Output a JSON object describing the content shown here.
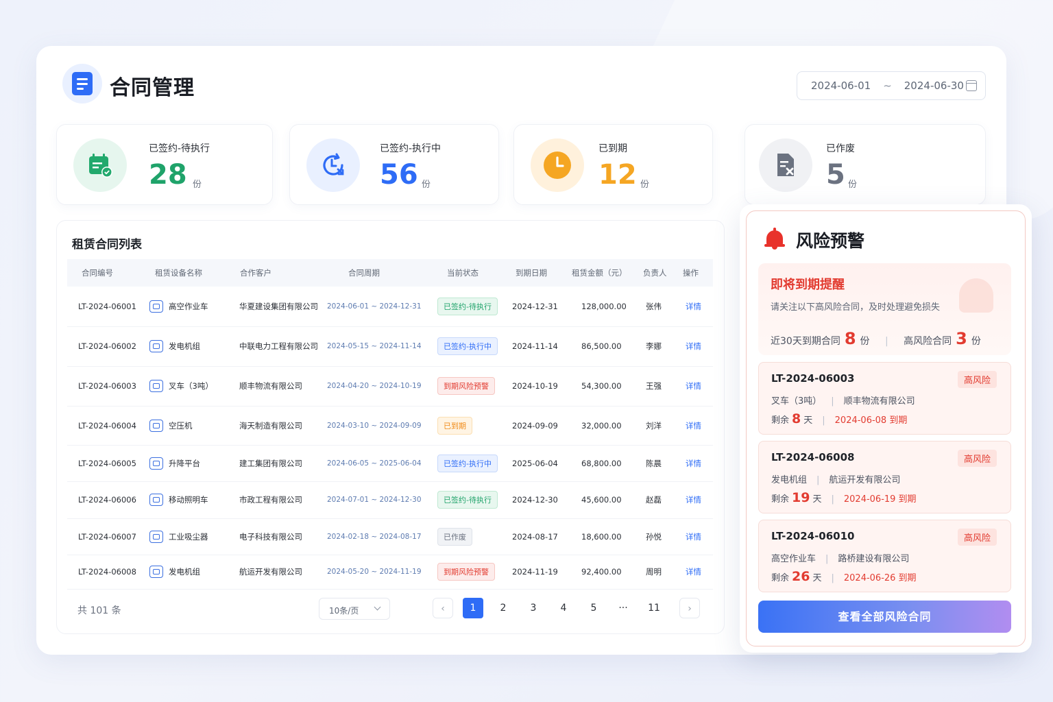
{
  "header": {
    "title": "合同管理",
    "date_start": "2024-06-01",
    "date_sep": "~",
    "date_end": "2024-06-30"
  },
  "stats": [
    {
      "label": "已签约-待执行",
      "value": "28",
      "unit": "份",
      "color": "#1fa36a"
    },
    {
      "label": "已签约-执行中",
      "value": "56",
      "unit": "份",
      "color": "#2e6cf6"
    },
    {
      "label": "已到期",
      "value": "12",
      "unit": "份",
      "color": "#f5a623"
    },
    {
      "label": "已作废",
      "value": "5",
      "unit": "份",
      "color": "#6b7280"
    }
  ],
  "list": {
    "title": "租赁合同列表",
    "columns": [
      "合同编号",
      "租赁设备名称",
      "合作客户",
      "合同周期",
      "当前状态",
      "到期日期",
      "租赁金额（元）",
      "负责人",
      "操作"
    ],
    "rows": [
      {
        "id": "LT-2024-06001",
        "equip": "高空作业车",
        "client": "华夏建设集团有限公司",
        "period": "2024-06-01 ~ 2024-12-31",
        "status": "已签约-待执行",
        "due": "2024-12-31",
        "amount": "128,000.00",
        "owner": "张伟",
        "action": "详情"
      },
      {
        "id": "LT-2024-06002",
        "equip": "发电机组",
        "client": "中联电力工程有限公司",
        "period": "2024-05-15 ~ 2024-11-14",
        "status": "已签约-执行中",
        "due": "2024-11-14",
        "amount": "86,500.00",
        "owner": "李娜",
        "action": "详情"
      },
      {
        "id": "LT-2024-06003",
        "equip": "叉车（3吨）",
        "client": "顺丰物流有限公司",
        "period": "2024-04-20 ~ 2024-10-19",
        "status": "到期风险预警",
        "due": "2024-10-19",
        "amount": "54,300.00",
        "owner": "王强",
        "action": "详情"
      },
      {
        "id": "LT-2024-06004",
        "equip": "空压机",
        "client": "海天制造有限公司",
        "period": "2024-03-10 ~ 2024-09-09",
        "status": "已到期",
        "due": "2024-09-09",
        "amount": "32,000.00",
        "owner": "刘洋",
        "action": "详情"
      },
      {
        "id": "LT-2024-06005",
        "equip": "升降平台",
        "client": "建工集团有限公司",
        "period": "2024-06-05 ~ 2025-06-04",
        "status": "已签约-执行中",
        "due": "2025-06-04",
        "amount": "68,800.00",
        "owner": "陈晨",
        "action": "详情"
      },
      {
        "id": "LT-2024-06006",
        "equip": "移动照明车",
        "client": "市政工程有限公司",
        "period": "2024-07-01 ~ 2024-12-30",
        "status": "已签约-待执行",
        "due": "2024-12-30",
        "amount": "45,600.00",
        "owner": "赵磊",
        "action": "详情"
      },
      {
        "id": "LT-2024-06007",
        "equip": "工业吸尘器",
        "client": "电子科技有限公司",
        "period": "2024-02-18 ~ 2024-08-17",
        "status": "已作废",
        "due": "2024-08-17",
        "amount": "18,600.00",
        "owner": "孙悦",
        "action": "详情"
      },
      {
        "id": "LT-2024-06008",
        "equip": "发电机组",
        "client": "航运开发有限公司",
        "period": "2024-05-20 ~ 2024-11-19",
        "status": "到期风险预警",
        "due": "2024-11-19",
        "amount": "92,400.00",
        "owner": "周明",
        "action": "详情"
      }
    ],
    "status_colors": {
      "已签约-待执行": {
        "fg": "#1fa36a",
        "bg": "#e8f7ef",
        "bd": "#bfe9d2"
      },
      "已签约-执行中": {
        "fg": "#2e6cf6",
        "bg": "#eaf1ff",
        "bd": "#c7d8fb"
      },
      "到期风险预警": {
        "fg": "#e23b30",
        "bg": "#fdeceb",
        "bd": "#f6c7c2"
      },
      "已到期": {
        "fg": "#f08c1a",
        "bg": "#fff4e3",
        "bd": "#fbdfb3"
      },
      "已作废": {
        "fg": "#6b7280",
        "bg": "#f1f3f6",
        "bd": "#dfe3ea"
      }
    }
  },
  "pager": {
    "total": "共 101 条",
    "page_size": "10条/页",
    "prev": "‹",
    "next": "›",
    "pages": [
      "1",
      "2",
      "3",
      "4",
      "5",
      "···",
      "11"
    ],
    "current": "1"
  },
  "risk": {
    "title": "风险预警",
    "remind_title": "即将到期提醒",
    "remind_sub": "请关注以下高风险合同，及时处理避免损失",
    "near_label": "近30天到期合同",
    "near_value": "8",
    "near_unit": "份",
    "high_label": "高风险合同",
    "high_value": "3",
    "high_unit": "份",
    "items": [
      {
        "code": "LT-2024-06003",
        "tag": "高风险",
        "equip": "叉车（3吨）",
        "client": "顺丰物流有限公司",
        "remain_label": "剩余",
        "remain": "8",
        "remain_unit": "天",
        "due": "2024-06-08 到期"
      },
      {
        "code": "LT-2024-06008",
        "tag": "高风险",
        "equip": "发电机组",
        "client": "航运开发有限公司",
        "remain_label": "剩余",
        "remain": "19",
        "remain_unit": "天",
        "due": "2024-06-19 到期"
      },
      {
        "code": "LT-2024-06010",
        "tag": "高风险",
        "equip": "高空作业车",
        "client": "路桥建设有限公司",
        "remain_label": "剩余",
        "remain": "26",
        "remain_unit": "天",
        "due": "2024-06-26 到期"
      }
    ],
    "button": "查看全部风险合同"
  }
}
